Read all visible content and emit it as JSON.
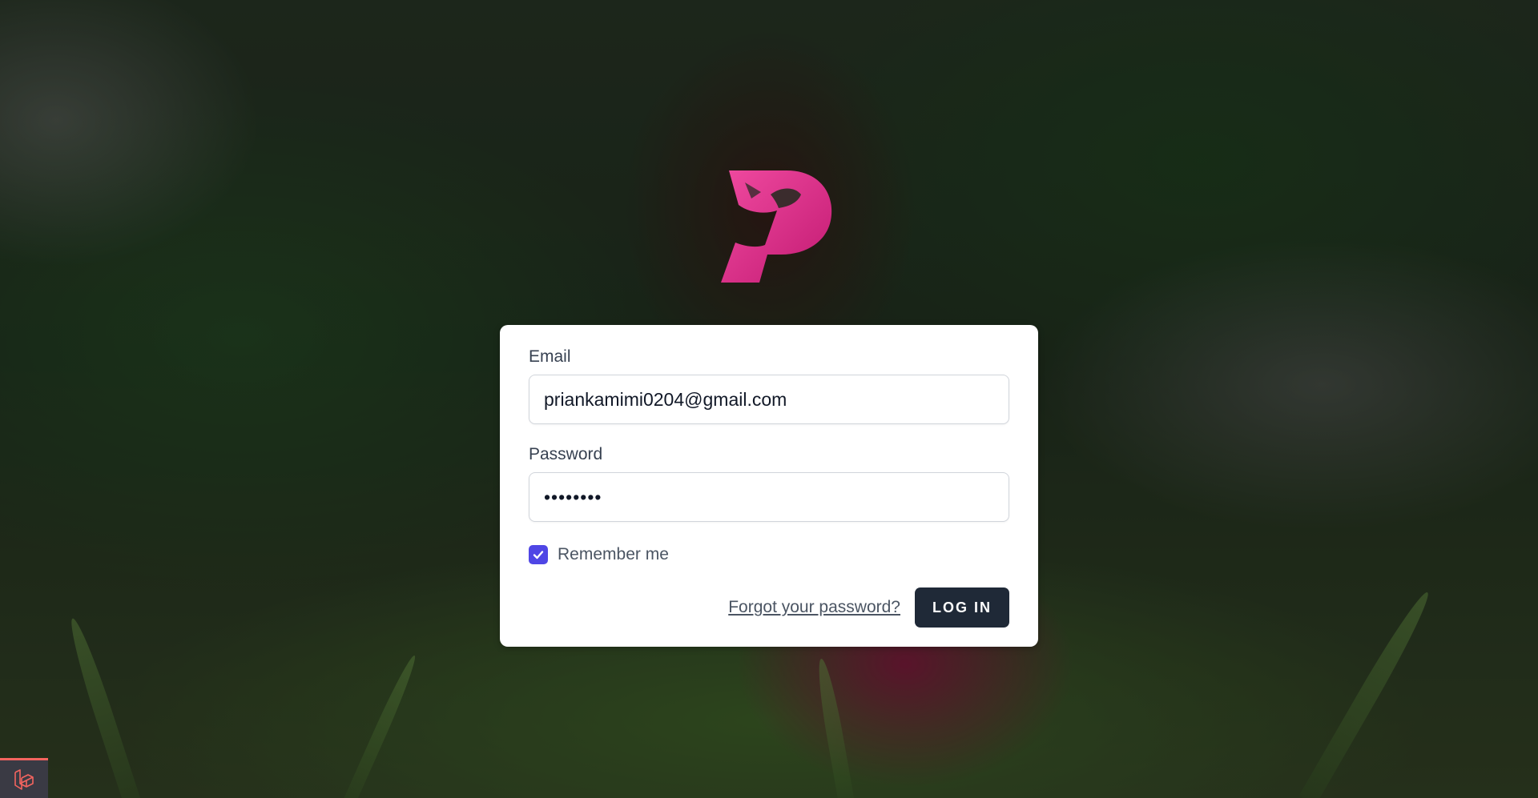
{
  "login": {
    "email_label": "Email",
    "email_value": "priankamimi0204@gmail.com",
    "password_label": "Password",
    "password_value": "••••••••",
    "remember_label": "Remember me",
    "remember_checked": true,
    "forgot_link": "Forgot your password?",
    "login_button": "LOG IN"
  },
  "colors": {
    "logo": "#e0338f",
    "checkbox": "#4f46e5",
    "button": "#1f2937"
  },
  "icons": {
    "logo": "dragon-p-logo-icon",
    "debugbar": "laravel-icon"
  }
}
